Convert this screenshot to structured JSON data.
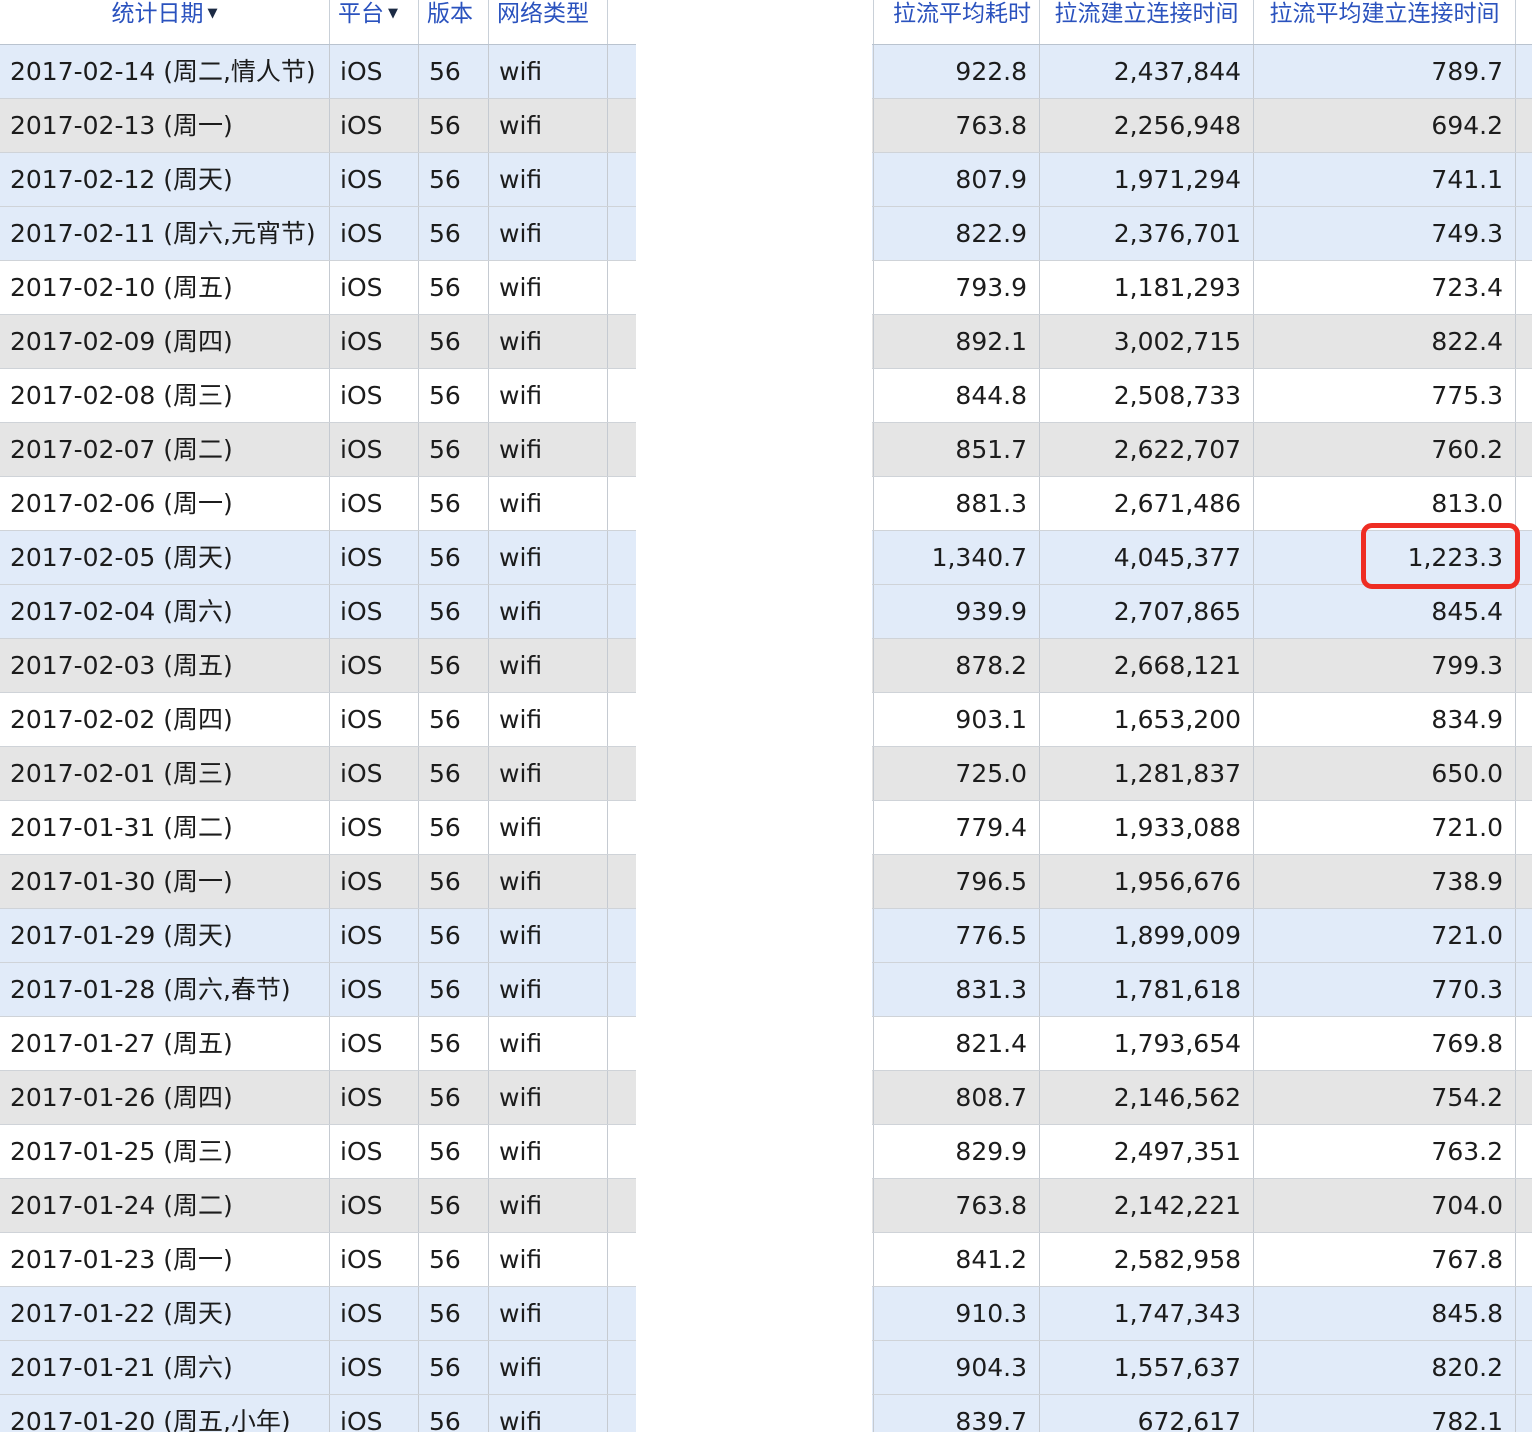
{
  "columns": [
    {
      "label": "统计日期",
      "sortable": true
    },
    {
      "label": "平台",
      "sortable": true
    },
    {
      "label": "版本",
      "sortable": false
    },
    {
      "label": "网络类型",
      "sortable": false
    },
    {
      "label": "拉流平均耗时",
      "sortable": false
    },
    {
      "label": "拉流建立连接时间",
      "sortable": false
    },
    {
      "label": "拉流平均建立连接时间",
      "sortable": false
    }
  ],
  "highlighted_cell": {
    "row": 9,
    "column": "avg_connect_time",
    "value": "1,223.3",
    "color": "#ee2d23"
  },
  "colors": {
    "header_text": "#2a52be",
    "holiday_row": "#e1ebf9",
    "weekday_odd_row": "#e5e5e5",
    "weekday_even_row": "#ffffff"
  },
  "rows": [
    {
      "date": "2017-02-14 (周二,情人节)",
      "platform": "iOS",
      "version": "56",
      "network": "wifi",
      "avg_time": "922.8",
      "connect_time": "2,437,844",
      "avg_connect_time": "789.7",
      "style": "holiday"
    },
    {
      "date": "2017-02-13 (周一)",
      "platform": "iOS",
      "version": "56",
      "network": "wifi",
      "avg_time": "763.8",
      "connect_time": "2,256,948",
      "avg_connect_time": "694.2",
      "style": "odd"
    },
    {
      "date": "2017-02-12 (周天)",
      "platform": "iOS",
      "version": "56",
      "network": "wifi",
      "avg_time": "807.9",
      "connect_time": "1,971,294",
      "avg_connect_time": "741.1",
      "style": "holiday"
    },
    {
      "date": "2017-02-11 (周六,元宵节)",
      "platform": "iOS",
      "version": "56",
      "network": "wifi",
      "avg_time": "822.9",
      "connect_time": "2,376,701",
      "avg_connect_time": "749.3",
      "style": "holiday"
    },
    {
      "date": "2017-02-10 (周五)",
      "platform": "iOS",
      "version": "56",
      "network": "wifi",
      "avg_time": "793.9",
      "connect_time": "1,181,293",
      "avg_connect_time": "723.4",
      "style": "even"
    },
    {
      "date": "2017-02-09 (周四)",
      "platform": "iOS",
      "version": "56",
      "network": "wifi",
      "avg_time": "892.1",
      "connect_time": "3,002,715",
      "avg_connect_time": "822.4",
      "style": "odd"
    },
    {
      "date": "2017-02-08 (周三)",
      "platform": "iOS",
      "version": "56",
      "network": "wifi",
      "avg_time": "844.8",
      "connect_time": "2,508,733",
      "avg_connect_time": "775.3",
      "style": "even"
    },
    {
      "date": "2017-02-07 (周二)",
      "platform": "iOS",
      "version": "56",
      "network": "wifi",
      "avg_time": "851.7",
      "connect_time": "2,622,707",
      "avg_connect_time": "760.2",
      "style": "odd"
    },
    {
      "date": "2017-02-06 (周一)",
      "platform": "iOS",
      "version": "56",
      "network": "wifi",
      "avg_time": "881.3",
      "connect_time": "2,671,486",
      "avg_connect_time": "813.0",
      "style": "even"
    },
    {
      "date": "2017-02-05 (周天)",
      "platform": "iOS",
      "version": "56",
      "network": "wifi",
      "avg_time": "1,340.7",
      "connect_time": "4,045,377",
      "avg_connect_time": "1,223.3",
      "style": "holiday"
    },
    {
      "date": "2017-02-04 (周六)",
      "platform": "iOS",
      "version": "56",
      "network": "wifi",
      "avg_time": "939.9",
      "connect_time": "2,707,865",
      "avg_connect_time": "845.4",
      "style": "holiday"
    },
    {
      "date": "2017-02-03 (周五)",
      "platform": "iOS",
      "version": "56",
      "network": "wifi",
      "avg_time": "878.2",
      "connect_time": "2,668,121",
      "avg_connect_time": "799.3",
      "style": "odd"
    },
    {
      "date": "2017-02-02 (周四)",
      "platform": "iOS",
      "version": "56",
      "network": "wifi",
      "avg_time": "903.1",
      "connect_time": "1,653,200",
      "avg_connect_time": "834.9",
      "style": "even"
    },
    {
      "date": "2017-02-01 (周三)",
      "platform": "iOS",
      "version": "56",
      "network": "wifi",
      "avg_time": "725.0",
      "connect_time": "1,281,837",
      "avg_connect_time": "650.0",
      "style": "odd"
    },
    {
      "date": "2017-01-31 (周二)",
      "platform": "iOS",
      "version": "56",
      "network": "wifi",
      "avg_time": "779.4",
      "connect_time": "1,933,088",
      "avg_connect_time": "721.0",
      "style": "even"
    },
    {
      "date": "2017-01-30 (周一)",
      "platform": "iOS",
      "version": "56",
      "network": "wifi",
      "avg_time": "796.5",
      "connect_time": "1,956,676",
      "avg_connect_time": "738.9",
      "style": "odd"
    },
    {
      "date": "2017-01-29 (周天)",
      "platform": "iOS",
      "version": "56",
      "network": "wifi",
      "avg_time": "776.5",
      "connect_time": "1,899,009",
      "avg_connect_time": "721.0",
      "style": "holiday"
    },
    {
      "date": "2017-01-28 (周六,春节)",
      "platform": "iOS",
      "version": "56",
      "network": "wifi",
      "avg_time": "831.3",
      "connect_time": "1,781,618",
      "avg_connect_time": "770.3",
      "style": "holiday"
    },
    {
      "date": "2017-01-27 (周五)",
      "platform": "iOS",
      "version": "56",
      "network": "wifi",
      "avg_time": "821.4",
      "connect_time": "1,793,654",
      "avg_connect_time": "769.8",
      "style": "even"
    },
    {
      "date": "2017-01-26 (周四)",
      "platform": "iOS",
      "version": "56",
      "network": "wifi",
      "avg_time": "808.7",
      "connect_time": "2,146,562",
      "avg_connect_time": "754.2",
      "style": "odd"
    },
    {
      "date": "2017-01-25 (周三)",
      "platform": "iOS",
      "version": "56",
      "network": "wifi",
      "avg_time": "829.9",
      "connect_time": "2,497,351",
      "avg_connect_time": "763.2",
      "style": "even"
    },
    {
      "date": "2017-01-24 (周二)",
      "platform": "iOS",
      "version": "56",
      "network": "wifi",
      "avg_time": "763.8",
      "connect_time": "2,142,221",
      "avg_connect_time": "704.0",
      "style": "odd"
    },
    {
      "date": "2017-01-23 (周一)",
      "platform": "iOS",
      "version": "56",
      "network": "wifi",
      "avg_time": "841.2",
      "connect_time": "2,582,958",
      "avg_connect_time": "767.8",
      "style": "even"
    },
    {
      "date": "2017-01-22 (周天)",
      "platform": "iOS",
      "version": "56",
      "network": "wifi",
      "avg_time": "910.3",
      "connect_time": "1,747,343",
      "avg_connect_time": "845.8",
      "style": "holiday"
    },
    {
      "date": "2017-01-21 (周六)",
      "platform": "iOS",
      "version": "56",
      "network": "wifi",
      "avg_time": "904.3",
      "connect_time": "1,557,637",
      "avg_connect_time": "820.2",
      "style": "holiday"
    },
    {
      "date": "2017-01-20 (周五,小年)",
      "platform": "iOS",
      "version": "56",
      "network": "wifi",
      "avg_time": "839.7",
      "connect_time": "672,617",
      "avg_connect_time": "782.1",
      "style": "holiday"
    }
  ]
}
